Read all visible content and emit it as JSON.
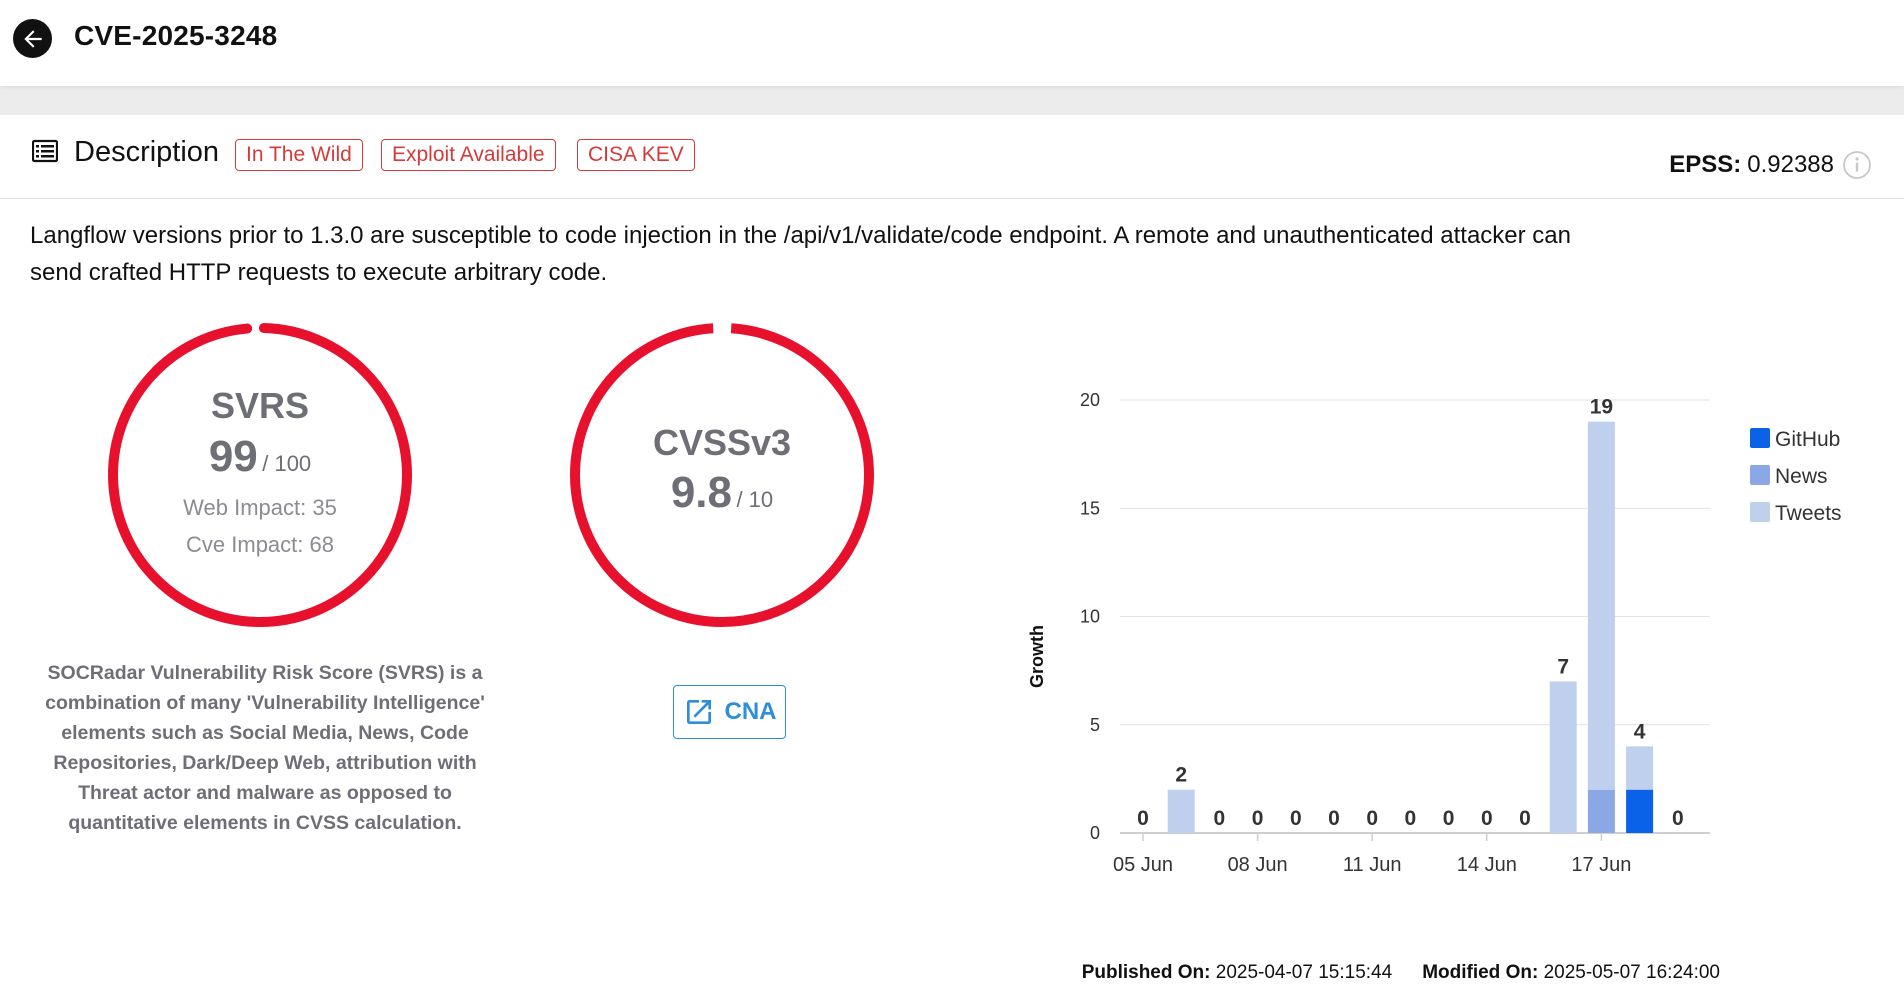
{
  "header": {
    "title": "CVE-2025-3248"
  },
  "description_section": {
    "title": "Description",
    "badges": [
      "In The Wild",
      "Exploit Available",
      "CISA KEV"
    ],
    "epss_label": "EPSS:",
    "epss_value": "0.92388",
    "text": "Langflow versions prior to 1.3.0 are susceptible to code injection in the /api/v1/validate/code endpoint. A remote and unauthenticated attacker can send crafted HTTP requests to execute arbitrary code."
  },
  "svrs": {
    "title": "SVRS",
    "score": "99",
    "max": "/ 100",
    "score_value": 99,
    "web_impact": "Web Impact: 35",
    "cve_impact": "Cve Impact: 68",
    "explanation": "SOCRadar Vulnerability Risk Score (SVRS) is a combination of many 'Vulnerability Intelligence' elements such as Social Media, News, Code Repositories, Dark/Deep Web, attribution with Threat actor and malware as opposed to quantitative elements in CVSS calculation."
  },
  "cvss": {
    "title": "CVSSv3",
    "score": "9.8",
    "max": "/ 10",
    "score_value": 9.8,
    "cna_label": "CNA"
  },
  "colors": {
    "gauge_red": "#e8112d",
    "badge_red": "#d63b3b",
    "github": "#0a62e8",
    "news": "#8aa7e6",
    "tweets": "#bfcfee",
    "link_blue": "#2d8fd8"
  },
  "chart_data": {
    "type": "bar",
    "stacked": true,
    "ylabel": "Growth",
    "ylim": [
      0,
      20
    ],
    "yticks": [
      0,
      5,
      10,
      15,
      20
    ],
    "x": [
      "05 Jun",
      "06 Jun",
      "07 Jun",
      "08 Jun",
      "09 Jun",
      "10 Jun",
      "11 Jun",
      "12 Jun",
      "13 Jun",
      "14 Jun",
      "15 Jun",
      "16 Jun",
      "17 Jun",
      "18 Jun",
      "19 Jun"
    ],
    "xtick_labels": [
      "05 Jun",
      "08 Jun",
      "11 Jun",
      "14 Jun",
      "17 Jun"
    ],
    "series": [
      {
        "name": "GitHub",
        "values": [
          0,
          0,
          0,
          0,
          0,
          0,
          0,
          0,
          0,
          0,
          0,
          0,
          0,
          2,
          0
        ]
      },
      {
        "name": "News",
        "values": [
          0,
          0,
          0,
          0,
          0,
          0,
          0,
          0,
          0,
          0,
          0,
          0,
          2,
          0,
          0
        ]
      },
      {
        "name": "Tweets",
        "values": [
          0,
          2,
          0,
          0,
          0,
          0,
          0,
          0,
          0,
          0,
          0,
          7,
          17,
          2,
          0
        ]
      }
    ],
    "totals": [
      0,
      2,
      0,
      0,
      0,
      0,
      0,
      0,
      0,
      0,
      0,
      7,
      19,
      4,
      0
    ],
    "legend_position": "right",
    "grid": true
  },
  "dates": {
    "published_label": "Published On:",
    "published_value": "2025-04-07 15:15:44",
    "modified_label": "Modified On:",
    "modified_value": "2025-05-07 16:24:00"
  }
}
